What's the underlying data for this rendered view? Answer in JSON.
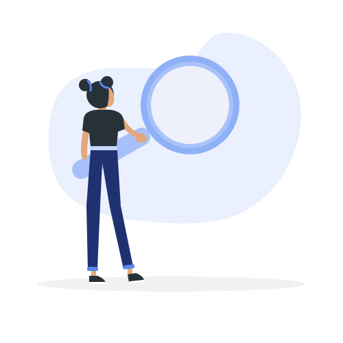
{
  "illustration": {
    "subject": "search",
    "colors": {
      "background": "#ffffff",
      "blob": "#eaf0fd",
      "blob_outline": "#d9e3fb",
      "ground_shadow": "#f1f1f1",
      "lens_ring": "#8fb0f7",
      "lens_ring_inner": "#a9c2fa",
      "lens_glass": "#eef1fb",
      "handle": "#a8c0f8",
      "hair": "#263238",
      "hair_accent": "#5b86f2",
      "skin": "#e2a77a",
      "shirt": "#263238",
      "pants": "#1f3170",
      "belt": "#c9d8ff",
      "cuffs": "#5b86f2",
      "shoes": "#263238",
      "shoe_sole": "#ffffff"
    }
  }
}
